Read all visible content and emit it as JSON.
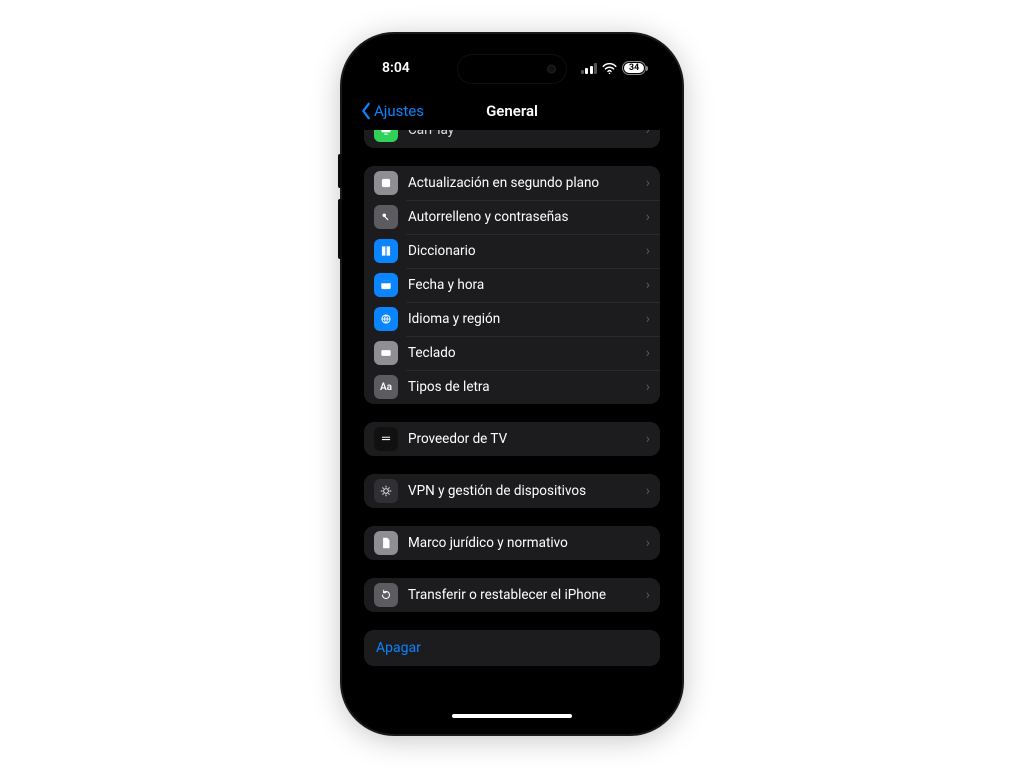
{
  "status": {
    "time": "8:04",
    "battery_pct": "34"
  },
  "nav": {
    "back": "Ajustes",
    "title": "General"
  },
  "peek": {
    "label": "CarPlay"
  },
  "group_main": [
    {
      "key": "bg-refresh",
      "label": "Actualización en segundo plano"
    },
    {
      "key": "autofill",
      "label": "Autorrelleno y contraseñas"
    },
    {
      "key": "dictionary",
      "label": "Diccionario"
    },
    {
      "key": "datetime",
      "label": "Fecha y hora"
    },
    {
      "key": "language",
      "label": "Idioma y región"
    },
    {
      "key": "keyboard",
      "label": "Teclado"
    },
    {
      "key": "fonts",
      "label": "Tipos de letra"
    }
  ],
  "group_tv": [
    {
      "key": "tvprovider",
      "label": "Proveedor de TV"
    }
  ],
  "group_vpn": [
    {
      "key": "vpn",
      "label": "VPN y gestión de dispositivos"
    }
  ],
  "group_legal": [
    {
      "key": "legal",
      "label": "Marco jurídico y normativo"
    }
  ],
  "group_transfer": [
    {
      "key": "transfer",
      "label": "Transferir o restablecer el iPhone"
    }
  ],
  "shutdown": {
    "label": "Apagar"
  }
}
